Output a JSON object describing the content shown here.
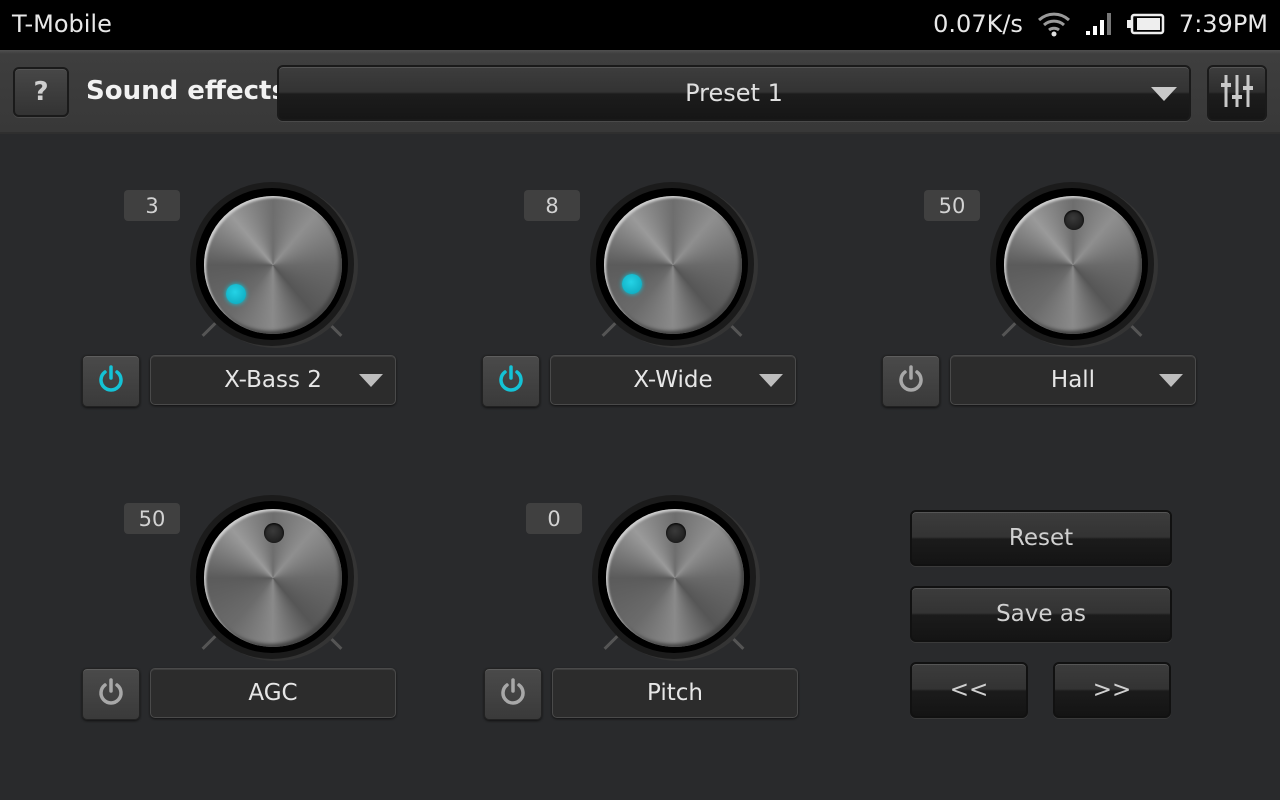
{
  "status_bar": {
    "carrier": "T-Mobile",
    "net_speed": "0.07K/s",
    "wifi_icon": "wifi-icon",
    "signal_icon": "signal-icon",
    "battery_icon": "battery-icon",
    "time": "7:39PM"
  },
  "toolbar": {
    "help_label": "?",
    "title": "Sound effects",
    "preset_selected": "Preset 1",
    "equalizer_icon": "equalizer-sliders-icon"
  },
  "colors": {
    "accent": "#14c3d6",
    "background": "#292a2c"
  },
  "effects": [
    {
      "name": "X-Bass 2",
      "value": "3",
      "enabled": true,
      "has_dropdown": true
    },
    {
      "name": "X-Wide",
      "value": "8",
      "enabled": true,
      "has_dropdown": true
    },
    {
      "name": "Hall",
      "value": "50",
      "enabled": false,
      "has_dropdown": true
    },
    {
      "name": "AGC",
      "value": "50",
      "enabled": false,
      "has_dropdown": false
    },
    {
      "name": "Pitch",
      "value": "0",
      "enabled": false,
      "has_dropdown": false
    }
  ],
  "actions": {
    "reset": "Reset",
    "save_as": "Save as",
    "prev": "<<",
    "next": ">>"
  }
}
